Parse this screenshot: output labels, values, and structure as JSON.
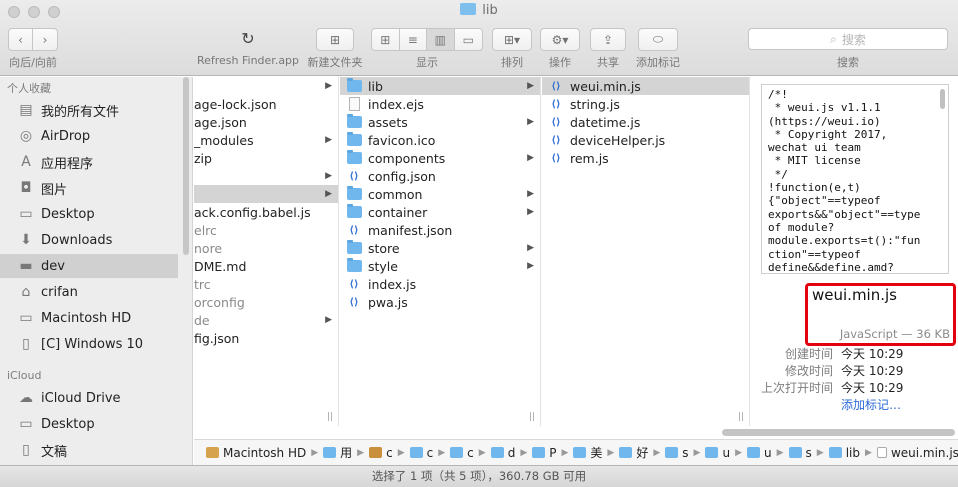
{
  "window": {
    "title": "lib"
  },
  "toolbar": {
    "nav_label": "向后/向前",
    "refresh_label": "Refresh Finder.app",
    "newfolder_label": "新建文件夹",
    "view_label": "显示",
    "arrange_label": "排列",
    "action_label": "操作",
    "share_label": "共享",
    "tags_label": "添加标记",
    "search_label": "搜索",
    "search_placeholder": "搜索"
  },
  "sidebar": {
    "favorites_header": "个人收藏",
    "icloud_header": "iCloud",
    "favorites": [
      {
        "label": "我的所有文件",
        "icon": "all-files-icon"
      },
      {
        "label": "AirDrop",
        "icon": "airdrop-icon"
      },
      {
        "label": "应用程序",
        "icon": "applications-icon"
      },
      {
        "label": "图片",
        "icon": "camera-icon"
      },
      {
        "label": "Desktop",
        "icon": "desktop-icon"
      },
      {
        "label": "Downloads",
        "icon": "downloads-icon"
      },
      {
        "label": "dev",
        "icon": "folder-icon",
        "selected": true
      },
      {
        "label": "crifan",
        "icon": "home-icon"
      },
      {
        "label": "Macintosh HD",
        "icon": "disk-icon"
      },
      {
        "label": "[C] Windows 10",
        "icon": "document-icon"
      }
    ],
    "icloud": [
      {
        "label": "iCloud Drive",
        "icon": "cloud-icon"
      },
      {
        "label": "Desktop",
        "icon": "desktop-icon"
      },
      {
        "label": "文稿",
        "icon": "document-icon"
      }
    ]
  },
  "columns": {
    "col1": [
      {
        "label": "",
        "arrow": true
      },
      {
        "label": "age-lock.json"
      },
      {
        "label": "age.json"
      },
      {
        "label": "_modules",
        "arrow": true
      },
      {
        "label": "zip"
      },
      {
        "label": "",
        "arrow": true
      },
      {
        "label": "",
        "arrow": true,
        "selected": true
      },
      {
        "label": "ack.config.babel.js"
      },
      {
        "label": "elrc",
        "dim": true
      },
      {
        "label": "nore",
        "dim": true
      },
      {
        "label": "DME.md"
      },
      {
        "label": "trc",
        "dim": true
      },
      {
        "label": "orconfig",
        "dim": true
      },
      {
        "label": "de",
        "dim": true,
        "arrow": true
      },
      {
        "label": "fig.json"
      }
    ],
    "col2": [
      {
        "label": "lib",
        "type": "folder",
        "arrow": true,
        "selected": true
      },
      {
        "label": "index.ejs",
        "type": "doc"
      },
      {
        "label": "assets",
        "type": "folder",
        "arrow": true
      },
      {
        "label": "favicon.ico",
        "type": "folder"
      },
      {
        "label": "components",
        "type": "folder",
        "arrow": true
      },
      {
        "label": "config.json",
        "type": "js"
      },
      {
        "label": "common",
        "type": "folder",
        "arrow": true
      },
      {
        "label": "container",
        "type": "folder",
        "arrow": true
      },
      {
        "label": "manifest.json",
        "type": "js"
      },
      {
        "label": "store",
        "type": "folder",
        "arrow": true
      },
      {
        "label": "style",
        "type": "folder",
        "arrow": true
      },
      {
        "label": "index.js",
        "type": "js"
      },
      {
        "label": "pwa.js",
        "type": "js"
      }
    ],
    "col3": [
      {
        "label": "weui.min.js",
        "type": "js",
        "selected": true
      },
      {
        "label": "string.js",
        "type": "js"
      },
      {
        "label": "datetime.js",
        "type": "js"
      },
      {
        "label": "deviceHelper.js",
        "type": "js"
      },
      {
        "label": "rem.js",
        "type": "js"
      }
    ]
  },
  "preview": {
    "code": "/*!\n * weui.js v1.1.1\n(https://weui.io)\n * Copyright 2017,\nwechat ui team\n * MIT license\n */\n!function(e,t)\n{\"object\"==typeof\nexports&&\"object\"==type\nof module?\nmodule.exports=t():\"fun\nction\"==typeof\ndefine&&define.amd?\ndefine([],t):\"object\"==",
    "filename": "weui.min.js",
    "kind": "JavaScript — 36 KB",
    "meta": [
      {
        "label": "创建时间",
        "value": "今天 10:29"
      },
      {
        "label": "修改时间",
        "value": "今天 10:29"
      },
      {
        "label": "上次打开时间",
        "value": "今天 10:29"
      }
    ],
    "add_tags": "添加标记…"
  },
  "pathbar": [
    {
      "label": "Macintosh HD",
      "icon": "hd"
    },
    {
      "label": "用",
      "icon": "folder"
    },
    {
      "label": "c",
      "icon": "home"
    },
    {
      "label": "c",
      "icon": "folder"
    },
    {
      "label": "c",
      "icon": "folder"
    },
    {
      "label": "d",
      "icon": "folder"
    },
    {
      "label": "P",
      "icon": "folder"
    },
    {
      "label": "美",
      "icon": "folder"
    },
    {
      "label": "好",
      "icon": "folder"
    },
    {
      "label": "s",
      "icon": "folder"
    },
    {
      "label": "u",
      "icon": "folder"
    },
    {
      "label": "u",
      "icon": "folder"
    },
    {
      "label": "s",
      "icon": "folder"
    },
    {
      "label": "lib",
      "icon": "folder"
    },
    {
      "label": "weui.min.js",
      "icon": "doc"
    }
  ],
  "status": "选择了 1 项（共 5 项），360.78 GB 可用"
}
